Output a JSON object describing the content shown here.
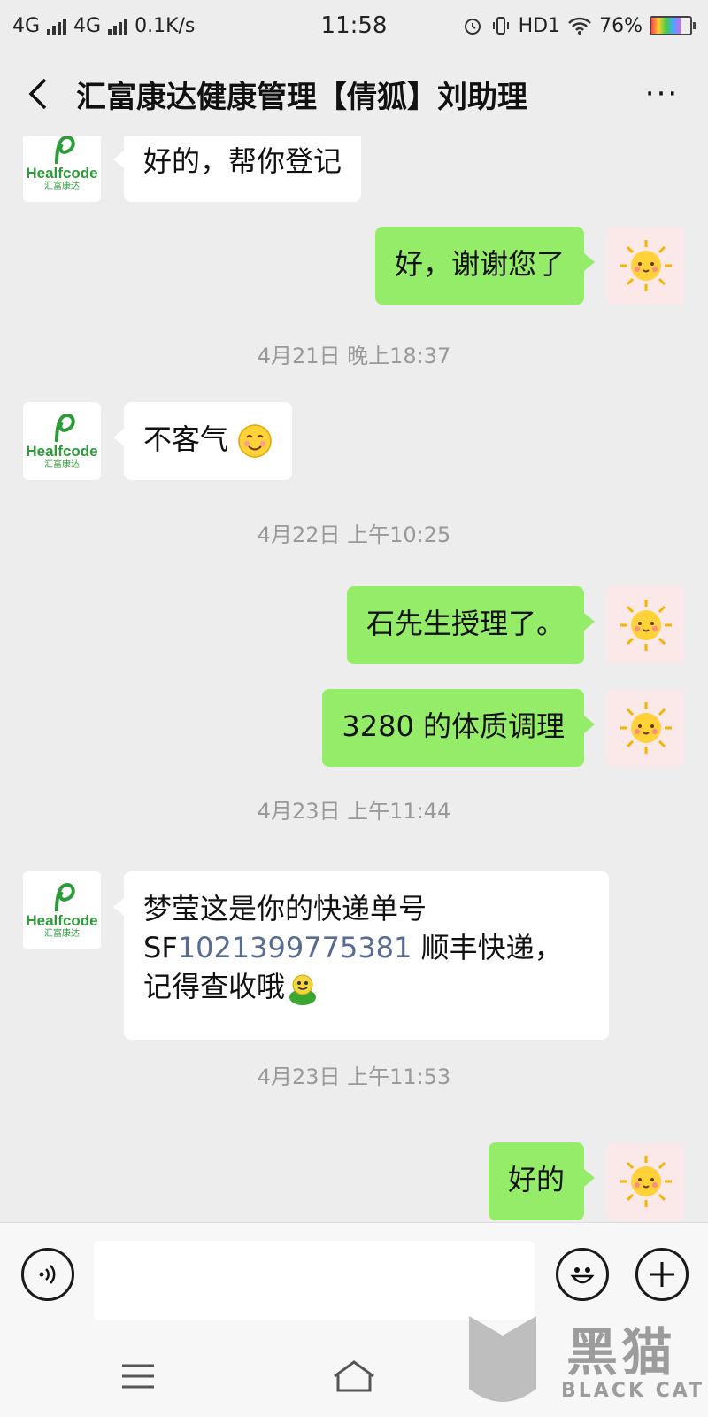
{
  "status_bar": {
    "network1": "4G",
    "network2": "4G",
    "speed": "0.1K/s",
    "time": "11:58",
    "hd": "HD1",
    "battery_percent": "76%",
    "battery_level": 0.76
  },
  "header": {
    "title": "汇富康达健康管理【倩狐】刘助理",
    "more_label": "···"
  },
  "contact_avatar": {
    "brand_word": "Healfcode",
    "brand_sub": "汇富康达",
    "color": "#2f9a3a"
  },
  "messages": [
    {
      "side": "left",
      "text": "好的，帮你登记"
    },
    {
      "side": "right",
      "text": "好，谢谢您了"
    },
    {
      "timestamp": "4月21日 晚上18:37"
    },
    {
      "side": "left",
      "text": "不客气",
      "emoji": "smile-emoji"
    },
    {
      "timestamp": "4月22日 上午10:25"
    },
    {
      "side": "right",
      "text": "石先生授理了。"
    },
    {
      "side": "right",
      "text": "3280 的体质调理"
    },
    {
      "timestamp": "4月23日 上午11:44"
    },
    {
      "side": "left",
      "line1": "梦莹这是你的快递单号",
      "line2_prefix": "SF",
      "line2_link": "1021399775381",
      "line2_suffix": " 顺丰快递，",
      "line3": "记得查收哦",
      "emoji": "frog-emoji"
    },
    {
      "timestamp": "4月23日 上午11:53"
    },
    {
      "side": "right",
      "text": "好的"
    }
  ],
  "input_bar": {
    "placeholder": ""
  },
  "watermark": {
    "text": "黑猫",
    "sub": "BLACK CAT"
  },
  "colors": {
    "bubble_self": "#95ec69",
    "bubble_other": "#ffffff",
    "background": "#ededed",
    "link": "#576b95"
  }
}
